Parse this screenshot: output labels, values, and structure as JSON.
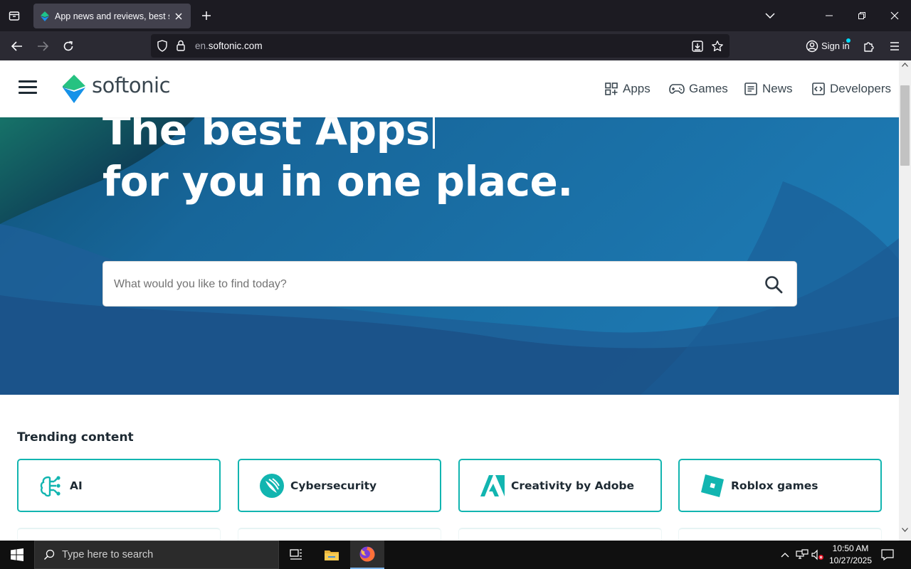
{
  "browser": {
    "tab_title": "App news and reviews, best soft",
    "url_prefix": "en.",
    "url_domain": "softonic.com",
    "signin_label": "Sign in"
  },
  "site": {
    "logo_text": "softonic",
    "nav": [
      {
        "label": "Apps",
        "icon": "apps-grid-icon"
      },
      {
        "label": "Games",
        "icon": "gamepad-icon"
      },
      {
        "label": "News",
        "icon": "news-icon"
      },
      {
        "label": "Developers",
        "icon": "code-icon"
      }
    ]
  },
  "hero": {
    "line1": "The best Apps",
    "line2": "for you in one place.",
    "search_placeholder": "What would you like to find today?"
  },
  "trending": {
    "title": "Trending content",
    "cards": [
      {
        "label": "AI",
        "icon": "ai-brain-icon"
      },
      {
        "label": "Cybersecurity",
        "icon": "cybersecurity-icon"
      },
      {
        "label": "Creativity by Adobe",
        "icon": "adobe-icon"
      },
      {
        "label": "Roblox games",
        "icon": "roblox-icon"
      }
    ]
  },
  "taskbar": {
    "search_placeholder": "Type here to search",
    "time": "10:50 AM",
    "date": "10/27/2025"
  },
  "colors": {
    "accent": "#12b5b0",
    "hero_blue": "#1b6fa5",
    "browser_dark": "#1c1b22"
  }
}
